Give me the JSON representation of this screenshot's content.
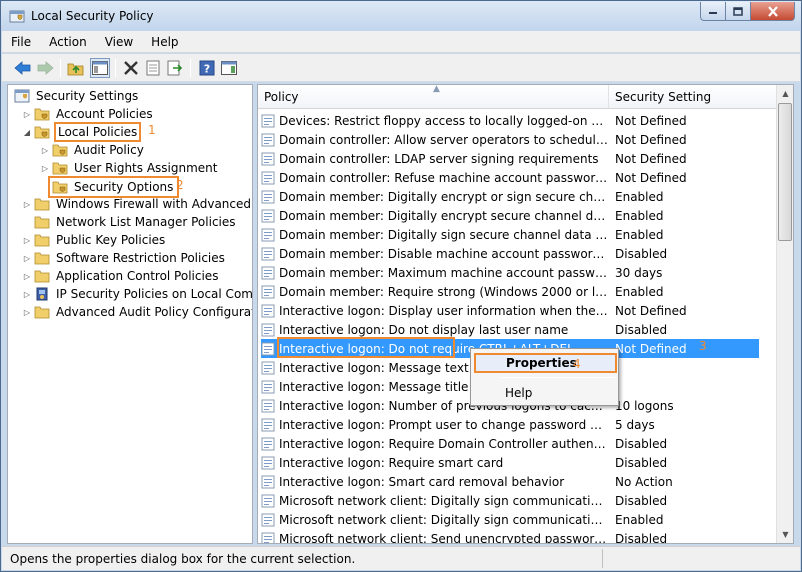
{
  "window": {
    "title": "Local Security Policy"
  },
  "menu": [
    "File",
    "Action",
    "View",
    "Help"
  ],
  "toolbar": {
    "icons": [
      "back-icon",
      "forward-icon",
      "up-folder-icon",
      "show-hide-tree-icon",
      "delete-icon",
      "properties-icon",
      "export-list-icon",
      "help-icon",
      "show-action-pane-icon"
    ]
  },
  "tree": {
    "root": "Security Settings",
    "items": [
      {
        "label": "Account Policies"
      },
      {
        "label": "Local Policies",
        "annotation": "1"
      },
      {
        "label": "Audit Policy"
      },
      {
        "label": "User Rights Assignment"
      },
      {
        "label": "Security Options",
        "annotation": "2"
      },
      {
        "label": "Windows Firewall with Advanced Secu"
      },
      {
        "label": "Network List Manager Policies"
      },
      {
        "label": "Public Key Policies"
      },
      {
        "label": "Software Restriction Policies"
      },
      {
        "label": "Application Control Policies"
      },
      {
        "label": "IP Security Policies on Local Compute"
      },
      {
        "label": "Advanced Audit Policy Configuration"
      }
    ]
  },
  "list": {
    "columns": [
      "Policy",
      "Security Setting"
    ],
    "rows": [
      {
        "policy": "Devices: Restrict floppy access to locally logged-on user only",
        "setting": "Not Defined"
      },
      {
        "policy": "Domain controller: Allow server operators to schedule tasks",
        "setting": "Not Defined"
      },
      {
        "policy": "Domain controller: LDAP server signing requirements",
        "setting": "Not Defined"
      },
      {
        "policy": "Domain controller: Refuse machine account password chan...",
        "setting": "Not Defined"
      },
      {
        "policy": "Domain member: Digitally encrypt or sign secure channel d...",
        "setting": "Enabled"
      },
      {
        "policy": "Domain member: Digitally encrypt secure channel data (wh...",
        "setting": "Enabled"
      },
      {
        "policy": "Domain member: Digitally sign secure channel data (when ...",
        "setting": "Enabled"
      },
      {
        "policy": "Domain member: Disable machine account password chan...",
        "setting": "Disabled"
      },
      {
        "policy": "Domain member: Maximum machine account password age",
        "setting": "30 days"
      },
      {
        "policy": "Domain member: Require strong (Windows 2000 or later) se...",
        "setting": "Enabled"
      },
      {
        "policy": "Interactive logon: Display user information when the session...",
        "setting": "Not Defined"
      },
      {
        "policy": "Interactive logon: Do not display last user name",
        "setting": "Disabled"
      },
      {
        "policy": "Interactive logon: Do not require CTRL+ALT+DEL",
        "setting": "Not Defined",
        "selected": true,
        "annotation": "3"
      },
      {
        "policy": "Interactive logon: Message text for u",
        "setting": ""
      },
      {
        "policy": "Interactive logon: Message title for u",
        "setting": ""
      },
      {
        "policy": "Interactive logon: Number of previous logons to cache (in ca...",
        "setting": "10 logons"
      },
      {
        "policy": "Interactive logon: Prompt user to change password before e...",
        "setting": "5 days"
      },
      {
        "policy": "Interactive logon: Require Domain Controller authentication...",
        "setting": "Disabled"
      },
      {
        "policy": "Interactive logon: Require smart card",
        "setting": "Disabled"
      },
      {
        "policy": "Interactive logon: Smart card removal behavior",
        "setting": "No Action"
      },
      {
        "policy": "Microsoft network client: Digitally sign communications (al...",
        "setting": "Disabled"
      },
      {
        "policy": "Microsoft network client: Digitally sign communications (if ...",
        "setting": "Enabled"
      },
      {
        "policy": "Microsoft network client: Send unencrypted password to thi...",
        "setting": "Disabled"
      }
    ]
  },
  "context_menu": {
    "items": [
      {
        "label": "Properties",
        "annotation": "4"
      },
      {
        "label": "Help"
      }
    ]
  },
  "status": {
    "text": "Opens the properties dialog box for the current selection."
  },
  "colors": {
    "highlight_annotation": "#f08a31",
    "selection": "#3399ff"
  }
}
